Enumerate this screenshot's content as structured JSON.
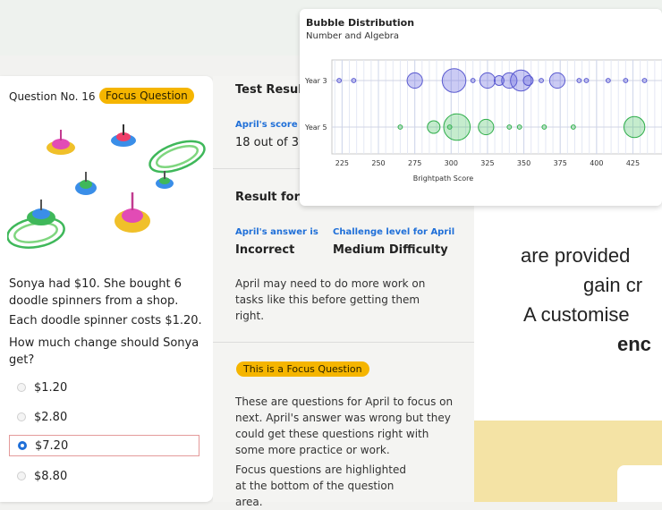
{
  "question": {
    "number_label": "Question No. 16",
    "focus_tag": "Focus Question",
    "text_lines": [
      "Sonya had $10. She bought 6 doodle spinners from a shop.",
      "Each doodle spinner costs $1.20.",
      "How much change should Sonya get?"
    ],
    "options": [
      {
        "label": "$1.20",
        "selected": false
      },
      {
        "label": "$2.80",
        "selected": false
      },
      {
        "label": "$7.20",
        "selected": true
      },
      {
        "label": "$8.80",
        "selected": false
      }
    ]
  },
  "results": {
    "test_title": "Test Results",
    "score_label": "April's score",
    "score_value": "18 out of 3",
    "result_title": "Result for",
    "answer_label": "April's answer is",
    "answer_value": "Incorrect",
    "challenge_label": "Challenge level for April",
    "challenge_value": "Medium Difficulty",
    "advice": "April may need to do more work on tasks like this before getting them right.",
    "focus_tag": "This is a Focus Question",
    "focus_text_1": "These are questions for April to focus on next. April's answer was wrong but they could get these questions right with some more practice or work.",
    "focus_text_2": "Focus questions are highlighted at the bottom of the question area."
  },
  "slogan": {
    "line1": "are provided",
    "line2": "gain cr",
    "line3": "A customise",
    "line4": "enc"
  },
  "colors": {
    "accent_yellow": "#f5b500",
    "link_blue": "#1f6fd8",
    "year3_color": "#6b6be0",
    "year5_color": "#3fbf5a"
  },
  "chart_data": {
    "type": "scatter",
    "title": "Bubble Distribution",
    "subtitle": "Number and Algebra",
    "xlabel": "Brightpath Score",
    "x_ticks": [
      225,
      250,
      275,
      300,
      325,
      350,
      375,
      400,
      425
    ],
    "xlim": [
      218,
      445
    ],
    "y_categories": [
      "Year 3",
      "Year 5"
    ],
    "grid": true,
    "series": [
      {
        "name": "Year 3",
        "points": [
          {
            "x": 223,
            "size": 1
          },
          {
            "x": 233,
            "size": 1
          },
          {
            "x": 275,
            "size": 4
          },
          {
            "x": 302,
            "size": 7
          },
          {
            "x": 315,
            "size": 1
          },
          {
            "x": 325,
            "size": 4
          },
          {
            "x": 333,
            "size": 2
          },
          {
            "x": 340,
            "size": 4
          },
          {
            "x": 348,
            "size": 6
          },
          {
            "x": 353,
            "size": 2
          },
          {
            "x": 362,
            "size": 1
          },
          {
            "x": 373,
            "size": 4
          },
          {
            "x": 388,
            "size": 1
          },
          {
            "x": 393,
            "size": 1
          },
          {
            "x": 408,
            "size": 1
          },
          {
            "x": 420,
            "size": 1
          },
          {
            "x": 433,
            "size": 1
          }
        ]
      },
      {
        "name": "Year 5",
        "points": [
          {
            "x": 265,
            "size": 1
          },
          {
            "x": 288,
            "size": 3
          },
          {
            "x": 299,
            "size": 1
          },
          {
            "x": 304,
            "size": 8
          },
          {
            "x": 324,
            "size": 4
          },
          {
            "x": 340,
            "size": 1
          },
          {
            "x": 347,
            "size": 1
          },
          {
            "x": 364,
            "size": 1
          },
          {
            "x": 384,
            "size": 1
          },
          {
            "x": 426,
            "size": 6
          }
        ]
      }
    ]
  }
}
